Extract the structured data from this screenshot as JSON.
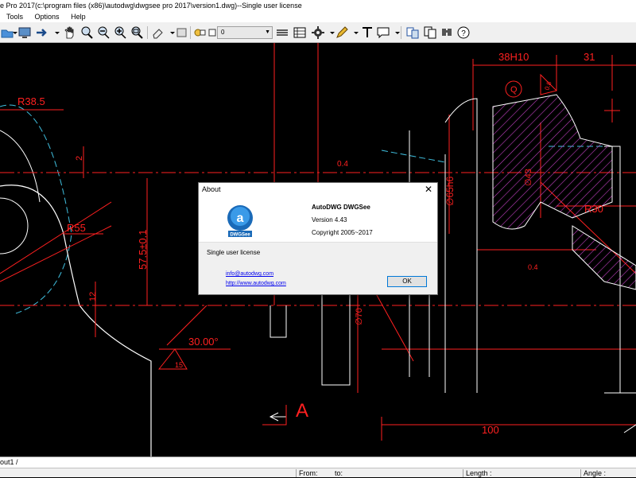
{
  "window": {
    "title": "e Pro 2017(c:\\program files (x86)\\autodwg\\dwgsee pro 2017\\version1.dwg)--Single user license"
  },
  "menu": {
    "items": [
      "Tools",
      "Options",
      "Help"
    ]
  },
  "toolbar": {
    "layer_value": "0",
    "icons": [
      "open-icon",
      "display-icon",
      "arrow-icon",
      "pan-hand-icon",
      "zoom-window-icon",
      "zoom-out-icon",
      "zoom-in-icon",
      "zoom-extents-icon",
      "eraser-icon",
      "layer-icon",
      "layer-toggle-icon",
      "lineweight-icon",
      "block-icon",
      "settings-icon",
      "pen-icon",
      "text-icon",
      "comment-icon",
      "compare-icon",
      "copy-icon",
      "find-icon",
      "help-icon"
    ]
  },
  "drawing": {
    "dims": {
      "d38h10": "38H10",
      "d31": "31",
      "r385": "R38.5",
      "d2": "2",
      "d04": "0.4",
      "r55": "R55",
      "d575": "57.5±0.1",
      "d12": "12",
      "d3000": "30.00°",
      "d15": "15",
      "d65h6": "∅65h6",
      "d43": "∅43",
      "r30": "R30",
      "d04b": "0.4",
      "d70": "∅70",
      "d100": "100",
      "dA": "A",
      "dQ": "Q",
      "d08": "0.8"
    }
  },
  "tabs": {
    "layout_tab": "out1"
  },
  "status": {
    "from": "From:",
    "to": "to:",
    "length": "Length :",
    "angle": "Angle :"
  },
  "about": {
    "title": "About",
    "close": "✕",
    "app_name": "AutoDWG DWGSee",
    "version": "Version 4.43",
    "copyright": "Copyright 2005~2017",
    "license": "Single user license",
    "email": "info@autodwg.com",
    "website": "http://www.autodwg.com",
    "ok": "OK",
    "logo_text": "DWGSee"
  },
  "colors": {
    "drawing_red": "#ff2020",
    "drawing_white": "#ffffff",
    "hatch_magenta": "#c040c0",
    "centerline_cyan": "#40c0e0",
    "accent_blue": "#0078d7"
  }
}
